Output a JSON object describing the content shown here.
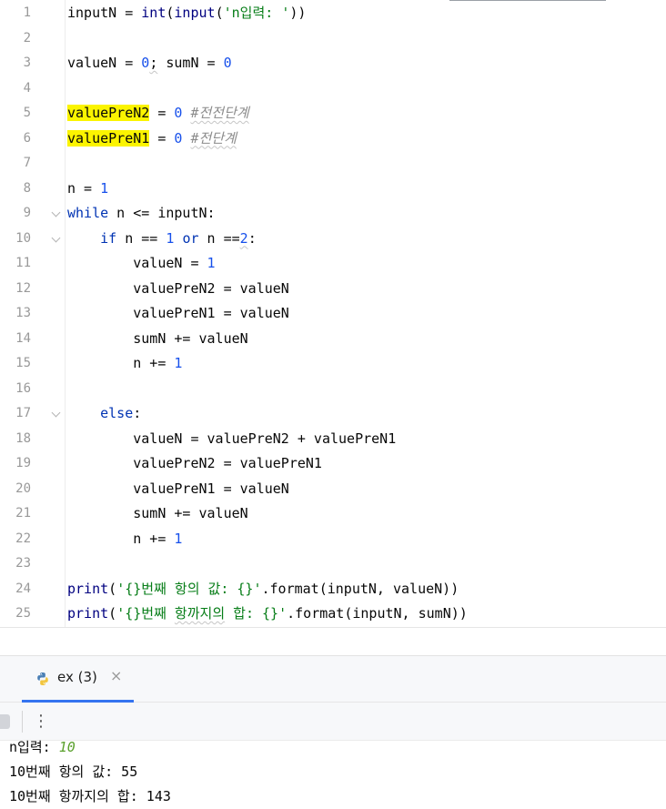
{
  "editor": {
    "lines": [
      {
        "n": "1",
        "tokens": [
          {
            "t": "inputN = "
          },
          {
            "t": "int",
            "c": "bi"
          },
          {
            "t": "("
          },
          {
            "t": "input",
            "c": "bi"
          },
          {
            "t": "("
          },
          {
            "t": "'n입력: '",
            "c": "str"
          },
          {
            "t": "))"
          }
        ]
      },
      {
        "n": "2",
        "tokens": []
      },
      {
        "n": "3",
        "tokens": [
          {
            "t": "valueN = "
          },
          {
            "t": "0",
            "c": "num"
          },
          {
            "t": ";",
            "c": "squig"
          },
          {
            "t": " sumN = "
          },
          {
            "t": "0",
            "c": "num"
          }
        ]
      },
      {
        "n": "4",
        "tokens": []
      },
      {
        "n": "5",
        "tokens": [
          {
            "t": "valuePreN2",
            "c": "hl"
          },
          {
            "t": " = "
          },
          {
            "t": "0",
            "c": "num"
          },
          {
            "t": " "
          },
          {
            "t": "#전전단계",
            "c": "cmt squig"
          }
        ]
      },
      {
        "n": "6",
        "tokens": [
          {
            "t": "valuePreN1",
            "c": "hl"
          },
          {
            "t": " = "
          },
          {
            "t": "0",
            "c": "num"
          },
          {
            "t": " "
          },
          {
            "t": "#전단계",
            "c": "cmt squig"
          }
        ]
      },
      {
        "n": "7",
        "tokens": []
      },
      {
        "n": "8",
        "tokens": [
          {
            "t": "n = "
          },
          {
            "t": "1",
            "c": "num"
          }
        ]
      },
      {
        "n": "9",
        "fold": true,
        "tokens": [
          {
            "t": "while",
            "c": "kw"
          },
          {
            "t": " n <= inputN:"
          }
        ]
      },
      {
        "n": "10",
        "fold": true,
        "tokens": [
          {
            "t": "    "
          },
          {
            "t": "if",
            "c": "kw"
          },
          {
            "t": " n == "
          },
          {
            "t": "1",
            "c": "num"
          },
          {
            "t": " "
          },
          {
            "t": "or",
            "c": "kw"
          },
          {
            "t": " n =="
          },
          {
            "t": "2",
            "c": "num squig"
          },
          {
            "t": ":"
          }
        ]
      },
      {
        "n": "11",
        "tokens": [
          {
            "t": "        valueN = "
          },
          {
            "t": "1",
            "c": "num"
          }
        ]
      },
      {
        "n": "12",
        "tokens": [
          {
            "t": "        valuePreN2 = valueN"
          }
        ]
      },
      {
        "n": "13",
        "tokens": [
          {
            "t": "        valuePreN1 = valueN"
          }
        ]
      },
      {
        "n": "14",
        "tokens": [
          {
            "t": "        sumN += valueN"
          }
        ]
      },
      {
        "n": "15",
        "tokens": [
          {
            "t": "        n += "
          },
          {
            "t": "1",
            "c": "num"
          }
        ]
      },
      {
        "n": "16",
        "tokens": []
      },
      {
        "n": "17",
        "fold": true,
        "tokens": [
          {
            "t": "    "
          },
          {
            "t": "else",
            "c": "kw"
          },
          {
            "t": ":"
          }
        ]
      },
      {
        "n": "18",
        "tokens": [
          {
            "t": "        valueN = valuePreN2 + valuePreN1"
          }
        ]
      },
      {
        "n": "19",
        "tokens": [
          {
            "t": "        valuePreN2 = valuePreN1"
          }
        ]
      },
      {
        "n": "20",
        "tokens": [
          {
            "t": "        valuePreN1 = valueN"
          }
        ]
      },
      {
        "n": "21",
        "tokens": [
          {
            "t": "        sumN += valueN"
          }
        ]
      },
      {
        "n": "22",
        "tokens": [
          {
            "t": "        n += "
          },
          {
            "t": "1",
            "c": "num"
          }
        ]
      },
      {
        "n": "23",
        "tokens": []
      },
      {
        "n": "24",
        "tokens": [
          {
            "t": "print",
            "c": "bi"
          },
          {
            "t": "("
          },
          {
            "t": "'{}번째 항의 값: {}'",
            "c": "str"
          },
          {
            "t": ".format(inputN, valueN))"
          }
        ]
      },
      {
        "n": "25",
        "tokens": [
          {
            "t": "print",
            "c": "bi"
          },
          {
            "t": "("
          },
          {
            "t": "'{}번째 ",
            "c": "str"
          },
          {
            "t": "항까지의",
            "c": "str squig"
          },
          {
            "t": " 합: {}'",
            "c": "str"
          },
          {
            "t": ".format(inputN, sumN))"
          }
        ]
      }
    ]
  },
  "run_panel": {
    "tab_label": "ex (3)",
    "tab_close": "×",
    "more_label": "⋮"
  },
  "console": {
    "line1_prompt": "n입력: ",
    "line1_input": "10",
    "line2": "10번째 항의 값: 55",
    "line3": "10번째 항까지의 합: 143"
  }
}
